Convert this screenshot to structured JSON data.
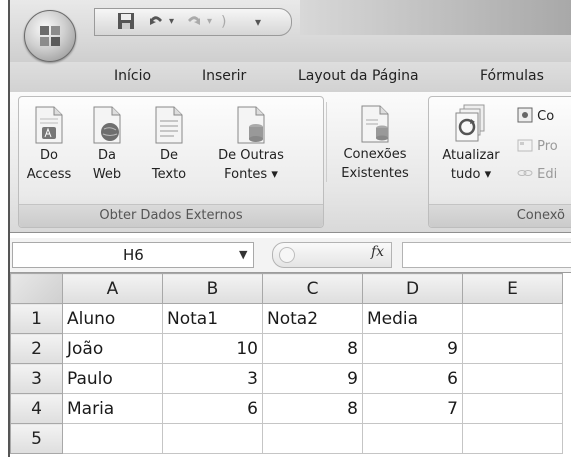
{
  "quick_access": {
    "save_icon": "save-icon",
    "undo_icon": "undo-icon",
    "redo_icon": "redo-icon",
    "customize_icon": "customize-icon"
  },
  "tabs": [
    "Início",
    "Inserir",
    "Layout da Página",
    "Fórmulas"
  ],
  "ribbon": {
    "group_external": {
      "label": "Obter Dados Externos",
      "buttons": [
        {
          "line1": "Do",
          "line2": "Access",
          "icon": "access-db-icon"
        },
        {
          "line1": "Da",
          "line2": "Web",
          "icon": "web-icon"
        },
        {
          "line1": "De",
          "line2": "Texto",
          "icon": "text-file-icon"
        },
        {
          "line1": "De Outras",
          "line2": "Fontes ▾",
          "icon": "other-sources-icon"
        }
      ]
    },
    "existing_connections": {
      "line1": "Conexões",
      "line2": "Existentes",
      "icon": "existing-connections-icon"
    },
    "group_connections": {
      "label": "Conexõ",
      "refresh": {
        "line1": "Atualizar",
        "line2": "tudo ▾",
        "icon": "refresh-icon"
      },
      "small_items": [
        {
          "label": "Co",
          "icon": "connections-icon",
          "enabled": true
        },
        {
          "label": "Pro",
          "icon": "properties-icon",
          "enabled": false
        },
        {
          "label": "Edi",
          "icon": "edit-links-icon",
          "enabled": false
        }
      ]
    }
  },
  "formula_bar": {
    "name_box": "H6",
    "fx_label": "fx",
    "formula": ""
  },
  "sheet": {
    "columns": [
      "A",
      "B",
      "C",
      "D",
      "E"
    ],
    "rows": [
      {
        "num": "1",
        "cells": [
          "Aluno",
          "Nota1",
          "Nota2",
          "Media",
          ""
        ]
      },
      {
        "num": "2",
        "cells": [
          "João",
          "10",
          "8",
          "9",
          ""
        ]
      },
      {
        "num": "3",
        "cells": [
          "Paulo",
          "3",
          "9",
          "6",
          ""
        ]
      },
      {
        "num": "4",
        "cells": [
          "Maria",
          "6",
          "8",
          "7",
          ""
        ]
      },
      {
        "num": "5",
        "cells": [
          "",
          "",
          "",
          "",
          ""
        ]
      }
    ]
  }
}
